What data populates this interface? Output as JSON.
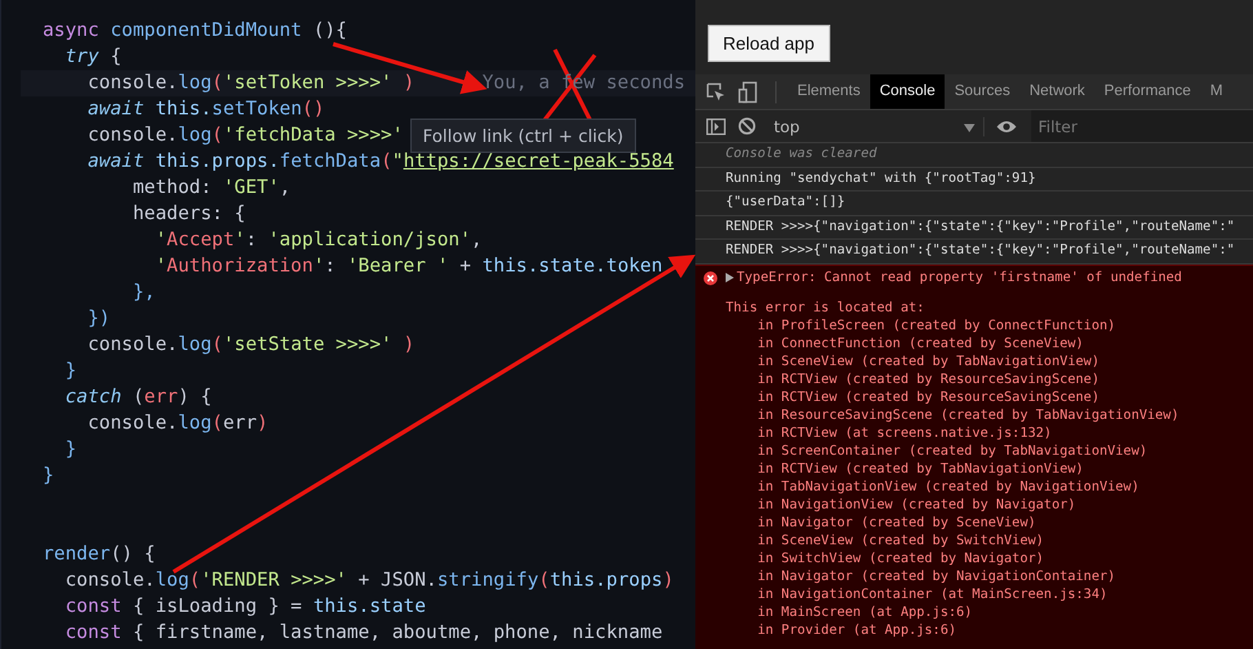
{
  "editor": {
    "lines": [
      {
        "kind": "code",
        "segments": [
          {
            "t": "async ",
            "kind": "kw"
          },
          {
            "t": "componentDidMount ",
            "kind": "fn"
          },
          {
            "t": "(){",
            "kind": "plain"
          }
        ]
      },
      {
        "kind": "code",
        "segments": [
          {
            "t": "  try",
            "kind": "kwi"
          },
          {
            "t": " {",
            "kind": "plain"
          }
        ]
      },
      {
        "kind": "code",
        "current": true,
        "segments": [
          {
            "t": "    console.",
            "kind": "plain"
          },
          {
            "t": "log",
            "kind": "fn"
          },
          {
            "t": "(",
            "kind": "punc"
          },
          {
            "t": "'setToken >>>>'",
            "kind": "str"
          },
          {
            "t": " )",
            "kind": "punc"
          },
          {
            "t": "      You, a few seconds",
            "kind": "blame"
          }
        ]
      },
      {
        "kind": "code",
        "segments": [
          {
            "t": "    await",
            "kind": "kwi"
          },
          {
            "t": " this.",
            "kind": "this"
          },
          {
            "t": "setToken",
            "kind": "fn"
          },
          {
            "t": "()",
            "kind": "punc"
          }
        ]
      },
      {
        "kind": "code",
        "segments": [
          {
            "t": "    console.",
            "kind": "plain"
          },
          {
            "t": "log",
            "kind": "fn"
          },
          {
            "t": "(",
            "kind": "punc"
          },
          {
            "t": "'fetchData >>>>'",
            "kind": "str"
          }
        ]
      },
      {
        "kind": "code",
        "segments": [
          {
            "t": "    await",
            "kind": "kwi"
          },
          {
            "t": " this.props.",
            "kind": "this"
          },
          {
            "t": "fetchData",
            "kind": "fn"
          },
          {
            "t": "(",
            "kind": "punc"
          },
          {
            "t": "\"",
            "kind": "str"
          },
          {
            "t": "https://secret-peak-5584",
            "kind": "url"
          }
        ]
      },
      {
        "kind": "code",
        "segments": [
          {
            "t": "        method: ",
            "kind": "plain"
          },
          {
            "t": "'GET'",
            "kind": "str"
          },
          {
            "t": ",",
            "kind": "plain"
          }
        ]
      },
      {
        "kind": "code",
        "segments": [
          {
            "t": "        headers: {",
            "kind": "plain"
          }
        ]
      },
      {
        "kind": "code",
        "segments": [
          {
            "t": "          '",
            "kind": "str"
          },
          {
            "t": "Accept",
            "kind": "key"
          },
          {
            "t": "'",
            "kind": "str"
          },
          {
            "t": ": ",
            "kind": "plain"
          },
          {
            "t": "'application/json'",
            "kind": "str"
          },
          {
            "t": ",",
            "kind": "plain"
          }
        ]
      },
      {
        "kind": "code",
        "segments": [
          {
            "t": "          '",
            "kind": "str"
          },
          {
            "t": "Authorization",
            "kind": "key"
          },
          {
            "t": "'",
            "kind": "str"
          },
          {
            "t": ": ",
            "kind": "plain"
          },
          {
            "t": "'Bearer '",
            "kind": "str"
          },
          {
            "t": " + ",
            "kind": "plain"
          },
          {
            "t": "this.state.token",
            "kind": "this"
          }
        ]
      },
      {
        "kind": "code",
        "segments": [
          {
            "t": "        },",
            "kind": "fn"
          }
        ]
      },
      {
        "kind": "code",
        "segments": [
          {
            "t": "    })",
            "kind": "fn"
          }
        ]
      },
      {
        "kind": "code",
        "segments": [
          {
            "t": "    console.",
            "kind": "plain"
          },
          {
            "t": "log",
            "kind": "fn"
          },
          {
            "t": "(",
            "kind": "punc"
          },
          {
            "t": "'setState >>>>'",
            "kind": "str"
          },
          {
            "t": " )",
            "kind": "punc"
          }
        ]
      },
      {
        "kind": "code",
        "segments": [
          {
            "t": "  }",
            "kind": "fn"
          }
        ]
      },
      {
        "kind": "code",
        "segments": [
          {
            "t": "  catch",
            "kind": "kwi"
          },
          {
            "t": " (",
            "kind": "plain"
          },
          {
            "t": "err",
            "kind": "punc"
          },
          {
            "t": ") {",
            "kind": "plain"
          }
        ]
      },
      {
        "kind": "code",
        "segments": [
          {
            "t": "    console.",
            "kind": "plain"
          },
          {
            "t": "log",
            "kind": "fn"
          },
          {
            "t": "(",
            "kind": "punc"
          },
          {
            "t": "err",
            "kind": "plain"
          },
          {
            "t": ")",
            "kind": "punc"
          }
        ]
      },
      {
        "kind": "code",
        "segments": [
          {
            "t": "  }",
            "kind": "fn"
          }
        ]
      },
      {
        "kind": "code",
        "segments": [
          {
            "t": "}",
            "kind": "fn"
          }
        ]
      },
      {
        "kind": "blank"
      },
      {
        "kind": "blank"
      },
      {
        "kind": "code",
        "segments": [
          {
            "t": "render",
            "kind": "fn"
          },
          {
            "t": "() {",
            "kind": "plain"
          }
        ]
      },
      {
        "kind": "code",
        "segments": [
          {
            "t": "  console.",
            "kind": "plain"
          },
          {
            "t": "log",
            "kind": "fn"
          },
          {
            "t": "(",
            "kind": "punc"
          },
          {
            "t": "'RENDER >>>>'",
            "kind": "str"
          },
          {
            "t": " + JSON.",
            "kind": "plain"
          },
          {
            "t": "stringify",
            "kind": "fn"
          },
          {
            "t": "(",
            "kind": "punc"
          },
          {
            "t": "this.props",
            "kind": "this"
          },
          {
            "t": ")",
            "kind": "punc"
          }
        ]
      },
      {
        "kind": "code",
        "segments": [
          {
            "t": "  const",
            "kind": "kw"
          },
          {
            "t": " { isLoading } = ",
            "kind": "plain"
          },
          {
            "t": "this.state",
            "kind": "this"
          }
        ]
      },
      {
        "kind": "code",
        "segments": [
          {
            "t": "  const",
            "kind": "kw"
          },
          {
            "t": " { firstname, lastname, aboutme, phone, nickname",
            "kind": "plain"
          }
        ]
      }
    ],
    "tooltip": "Follow link (ctrl + click)"
  },
  "devtools": {
    "reload_button": "Reload app",
    "tabs": [
      {
        "label": "Elements",
        "selected": false
      },
      {
        "label": "Console",
        "selected": true
      },
      {
        "label": "Sources",
        "selected": false
      },
      {
        "label": "Network",
        "selected": false
      },
      {
        "label": "Performance",
        "selected": false
      },
      {
        "label": "M",
        "selected": false
      }
    ],
    "context": "top",
    "filter": {
      "placeholder": "Filter"
    },
    "messages": [
      {
        "kind": "info",
        "text": "Console was cleared"
      },
      {
        "kind": "log",
        "text": "Running \"sendychat\" with {\"rootTag\":91}"
      },
      {
        "kind": "log",
        "text": "{\"userData\":[]}"
      },
      {
        "kind": "log",
        "text": "RENDER >>>>{\"navigation\":{\"state\":{\"key\":\"Profile\",\"routeName\":\""
      },
      {
        "kind": "log",
        "text": "RENDER >>>>{\"navigation\":{\"state\":{\"key\":\"Profile\",\"routeName\":\""
      },
      {
        "kind": "error",
        "text": "TypeError: Cannot read property 'firstname' of undefined",
        "expanded": false,
        "details": [
          "This error is located at:",
          "    in ProfileScreen (created by ConnectFunction)",
          "    in ConnectFunction (created by SceneView)",
          "    in SceneView (created by TabNavigationView)",
          "    in RCTView (created by ResourceSavingScene)",
          "    in RCTView (created by ResourceSavingScene)",
          "    in ResourceSavingScene (created by TabNavigationView)",
          "    in RCTView (at screens.native.js:132)",
          "    in ScreenContainer (created by TabNavigationView)",
          "    in RCTView (created by TabNavigationView)",
          "    in TabNavigationView (created by NavigationView)",
          "    in NavigationView (created by Navigator)",
          "    in Navigator (created by SceneView)",
          "    in SceneView (created by SwitchView)",
          "    in SwitchView (created by Navigator)",
          "    in Navigator (created by NavigationContainer)",
          "    in NavigationContainer (at MainScreen.js:34)",
          "    in MainScreen (at App.js:6)",
          "    in Provider (at App.js:6)"
        ]
      }
    ]
  }
}
